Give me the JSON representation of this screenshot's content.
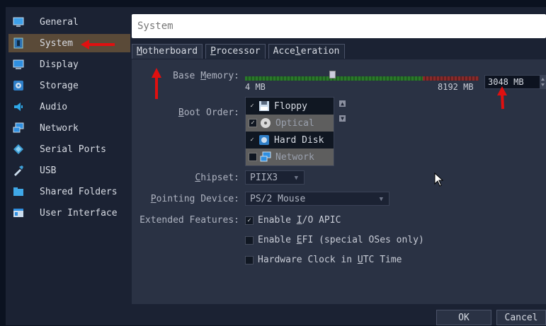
{
  "sidebar": {
    "items": [
      {
        "label": "General",
        "icon": "monitor-icon"
      },
      {
        "label": "System",
        "icon": "chip-icon"
      },
      {
        "label": "Display",
        "icon": "display-icon"
      },
      {
        "label": "Storage",
        "icon": "storage-icon"
      },
      {
        "label": "Audio",
        "icon": "speaker-icon"
      },
      {
        "label": "Network",
        "icon": "network-icon"
      },
      {
        "label": "Serial Ports",
        "icon": "serial-port-icon"
      },
      {
        "label": "USB",
        "icon": "usb-icon"
      },
      {
        "label": "Shared Folders",
        "icon": "folder-icon"
      },
      {
        "label": "User Interface",
        "icon": "window-icon"
      }
    ],
    "selected": "System"
  },
  "header": {
    "title": "System"
  },
  "tabs": [
    {
      "label_pre": "",
      "label_key": "M",
      "label_post": "otherboard",
      "active": true
    },
    {
      "label_pre": "",
      "label_key": "P",
      "label_post": "rocessor",
      "active": false
    },
    {
      "label_pre": "Acce",
      "label_key": "l",
      "label_post": "eration",
      "active": false
    }
  ],
  "motherboard": {
    "base_memory": {
      "label_pre": "Base ",
      "label_key": "M",
      "label_post": "emory:",
      "min_label": "4 MB",
      "max_label": "8192 MB",
      "value": "3048 MB",
      "value_fraction": 0.37,
      "safe_fraction": 0.76
    },
    "boot_order": {
      "label_pre": "",
      "label_key": "B",
      "label_post": "oot Order:",
      "items": [
        {
          "label": "Floppy",
          "checked": true,
          "icon": "floppy-icon",
          "dim": false
        },
        {
          "label": "Optical",
          "checked": true,
          "icon": "optical-disc-icon",
          "dim": true
        },
        {
          "label": "Hard Disk",
          "checked": true,
          "icon": "hard-disk-icon",
          "dim": false
        },
        {
          "label": "Network",
          "checked": false,
          "icon": "network-icon",
          "dim": true
        }
      ]
    },
    "chipset": {
      "label_pre": "",
      "label_key": "C",
      "label_post": "hipset:",
      "value": "PIIX3"
    },
    "pointing_device": {
      "label_pre": "",
      "label_key": "P",
      "label_post": "ointing Device:",
      "value": "PS/2 Mouse"
    },
    "extended_features": {
      "label": "Extended Features:",
      "options": [
        {
          "pre": "Enable ",
          "key": "I",
          "post": "/O APIC",
          "checked": true
        },
        {
          "pre": "Enable ",
          "key": "E",
          "post": "FI (special OSes only)",
          "checked": false
        },
        {
          "pre": "Hardware Clock in ",
          "key": "U",
          "post": "TC Time",
          "checked": false
        }
      ]
    }
  },
  "footer": {
    "ok": "OK",
    "cancel": "Cancel"
  },
  "colors": {
    "annotation": "#e01010",
    "selected": "#5a4a38",
    "accent_green": "#2a7a2a",
    "accent_red": "#8a2a2a"
  }
}
